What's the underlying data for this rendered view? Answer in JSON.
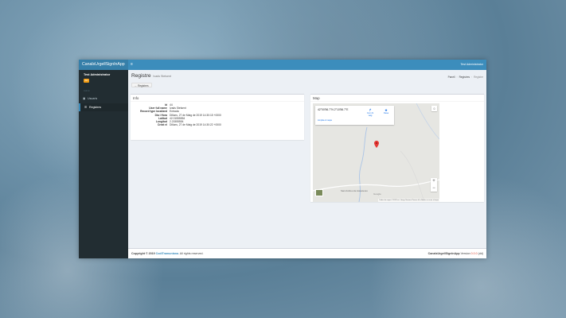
{
  "app": {
    "brand": "CanalsUrgellSignInApp",
    "toggle_icon": "hamburger-icon",
    "top_user": "Test Administrator"
  },
  "sidebar": {
    "user_name": "Test Administrator",
    "badge": "AD",
    "header": "Admin",
    "items": [
      {
        "label": "Usuaris",
        "icon": "users-icon"
      },
      {
        "label": "Registres",
        "icon": "list-icon",
        "active": true
      }
    ]
  },
  "page": {
    "title": "Registre",
    "subtitle": "Ivads Stelsent",
    "breadcrumbs": [
      "Panell",
      "Registres",
      "Registre"
    ],
    "back_button": "← Registres"
  },
  "info": {
    "title": "Info",
    "rows": [
      {
        "key": "Id",
        "value": "44"
      },
      {
        "key": "User full name",
        "value": "Ivads Stelsent"
      },
      {
        "key": "Record type localized",
        "value": "Entrada"
      },
      {
        "key": "Dia i Hora",
        "value": "Dilluns, 27 de Maig de 2019 14:30:15 +0000"
      },
      {
        "key": "Latitud",
        "value": "42.01555554"
      },
      {
        "key": "Longitud",
        "value": "2.21555554"
      },
      {
        "key": "Creat el",
        "value": "Dilluns, 27 de Maig de 2019 14:30:22 +0000"
      }
    ]
  },
  "map": {
    "title": "Map",
    "coords": "42°00'56.7\"N 2°10'56.7\"E",
    "directions": "Com hi vaig",
    "save": "Desa",
    "view_larger": "Amplia el mapa",
    "village": "Sant Andreu de Llavaneres",
    "google": "Google",
    "attribution": "Dades de mapes ©2019 Inst. Geogr. Nacional   Termes d'ús   Notifica un error al mapa"
  },
  "footer": {
    "copyright": "Copyright © 2019",
    "company": "CodiTramuntana",
    "rights": ". All rights reserved.",
    "app_name": "CanalsUrgellSignInApp",
    "version_label": "Version",
    "version": "0.0.0",
    "env": "(dd)"
  },
  "colors": {
    "header": "#3c8dbc",
    "sidebar": "#222d32",
    "accent_red": "#dd4b39",
    "pin": "#e53935"
  }
}
